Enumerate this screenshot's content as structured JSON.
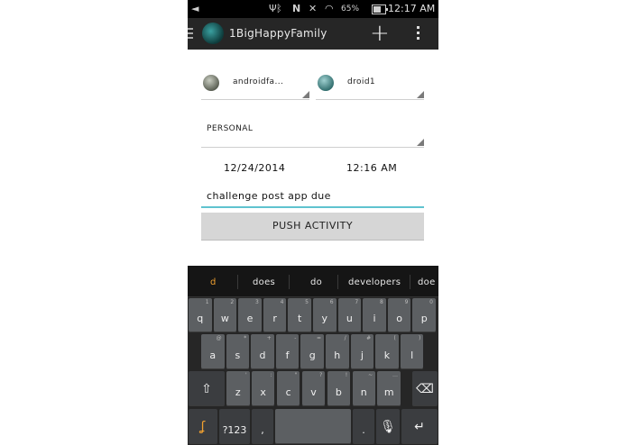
{
  "status_bar": {
    "battery": "65%",
    "time": "12:17 AM",
    "battery_level": 0.65
  },
  "action_bar": {
    "title": "1BigHappyFamily"
  },
  "form": {
    "spinner_1": "androidfa...",
    "spinner_2": "droid1",
    "category": "PERSONAL",
    "date": "12/24/2014",
    "time": "12:16 AM",
    "message": "challenge post app due",
    "push_button": "PUSH ACTIVITY"
  },
  "keyboard": {
    "suggestions": [
      "d",
      "does",
      "do",
      "developers",
      "doe"
    ],
    "row1": [
      {
        "k": "q",
        "s": "1"
      },
      {
        "k": "w",
        "s": "2"
      },
      {
        "k": "e",
        "s": "3"
      },
      {
        "k": "r",
        "s": "4"
      },
      {
        "k": "t",
        "s": "5"
      },
      {
        "k": "y",
        "s": "6"
      },
      {
        "k": "u",
        "s": "7"
      },
      {
        "k": "i",
        "s": "8"
      },
      {
        "k": "o",
        "s": "9"
      },
      {
        "k": "p",
        "s": "0"
      }
    ],
    "row2": [
      {
        "k": "a",
        "s": "@"
      },
      {
        "k": "s",
        "s": "*"
      },
      {
        "k": "d",
        "s": "+"
      },
      {
        "k": "f",
        "s": "-"
      },
      {
        "k": "g",
        "s": "="
      },
      {
        "k": "h",
        "s": "/"
      },
      {
        "k": "j",
        "s": "#"
      },
      {
        "k": "k",
        "s": "("
      },
      {
        "k": "l",
        "s": ")"
      }
    ],
    "row3": [
      {
        "k": "z",
        "s": "'"
      },
      {
        "k": "x",
        "s": ":"
      },
      {
        "k": "c",
        "s": "\""
      },
      {
        "k": "v",
        "s": "?"
      },
      {
        "k": "b",
        "s": "!"
      },
      {
        "k": "n",
        "s": "~"
      },
      {
        "k": "m",
        "s": "…"
      }
    ],
    "symbols_key": "?123",
    "comma_key": ",",
    "period_key": "."
  },
  "colors": {
    "accent": "#5fc3cf",
    "actionbar": "#262626",
    "suggestion_highlight": "#f0a030"
  },
  "icons": [
    "back-icon",
    "usb-icon",
    "bluetooth-icon",
    "nfc-icon",
    "mute-icon",
    "wifi-icon",
    "battery-icon",
    "drawer-icon",
    "add-icon",
    "overflow-icon",
    "shift-icon",
    "backspace-icon",
    "swype-icon",
    "mic-icon",
    "enter-icon"
  ]
}
